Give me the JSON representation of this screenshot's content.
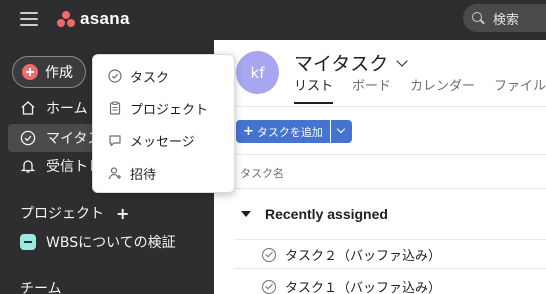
{
  "topbar": {
    "logo_text": "asana",
    "search_placeholder": "検索"
  },
  "sidebar": {
    "create_label": "作成",
    "items": [
      {
        "label": "ホーム",
        "icon": "home-icon"
      },
      {
        "label": "マイタスク",
        "icon": "check-circle-icon",
        "active": true
      },
      {
        "label": "受信トレイ",
        "icon": "bell-icon"
      }
    ],
    "projects_header": "プロジェクト",
    "projects": [
      {
        "label": "WBSについての検証"
      }
    ],
    "teams_header": "チーム"
  },
  "create_menu": {
    "items": [
      {
        "label": "タスク",
        "icon": "check-circle-icon"
      },
      {
        "label": "プロジェクト",
        "icon": "clipboard-icon"
      },
      {
        "label": "メッセージ",
        "icon": "chat-bubble-icon"
      },
      {
        "label": "招待",
        "icon": "add-user-icon"
      }
    ]
  },
  "main": {
    "avatar_initials": "kf",
    "title": "マイタスク",
    "tabs": [
      "リスト",
      "ボード",
      "カレンダー",
      "ファイル"
    ],
    "add_task_label": "タスクを追加",
    "column_header": "タスク名",
    "section_title": "Recently assigned",
    "tasks": [
      "タスク２（バッファ込み）",
      "タスク１（バッファ込み）"
    ]
  },
  "colors": {
    "sidebar_bg": "#2e2e30",
    "accent_blue": "#4573d2",
    "brand_coral": "#f06a6a",
    "avatar_purple": "#a8a6f0"
  }
}
